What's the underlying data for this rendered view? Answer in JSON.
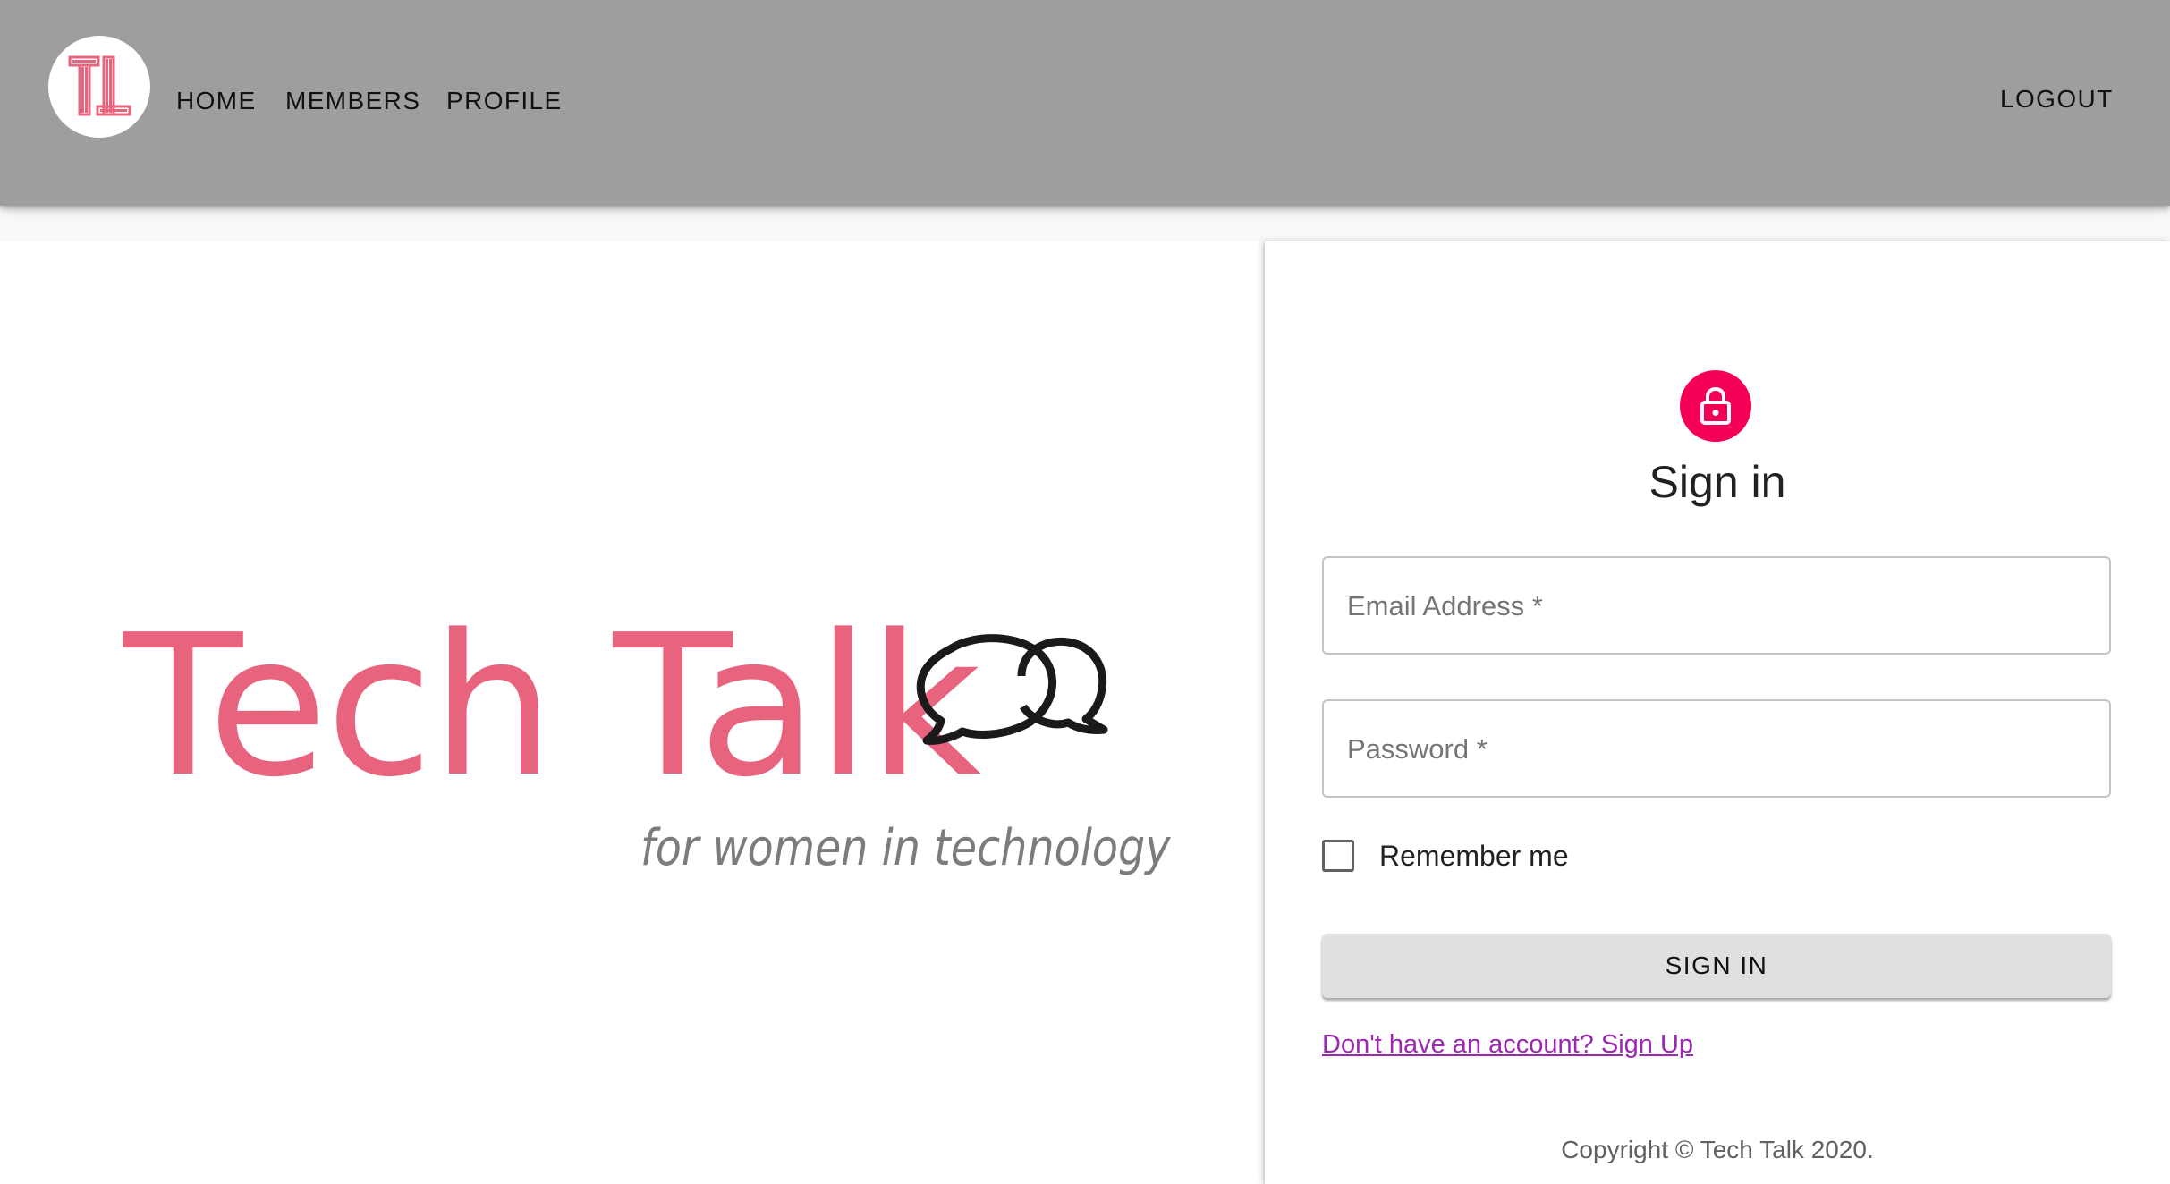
{
  "header": {
    "logo": {
      "icon": "tech-talk-monogram-icon",
      "text": "TT"
    },
    "nav": [
      {
        "label": "HOME"
      },
      {
        "label": "MEMBERS"
      },
      {
        "label": "PROFILE"
      }
    ],
    "logout_label": "LOGOUT"
  },
  "brand": {
    "title": "Tech Talk",
    "tagline": "for women in technology",
    "icon": "speech-bubbles-icon"
  },
  "signin": {
    "avatar_icon": "lock-icon",
    "title": "Sign in",
    "email_label": "Email Address *",
    "email_value": "",
    "password_label": "Password *",
    "password_value": "",
    "remember_label": "Remember me",
    "remember_checked": false,
    "button_label": "SIGN IN",
    "signup_link": "Don't have an account? Sign Up",
    "copyright": "Copyright © Tech Talk 2020."
  },
  "colors": {
    "appbar": "#9e9e9e",
    "brand_pink": "#e8637e",
    "avatar_pink": "#f50057",
    "link_purple": "#9c27b0",
    "button_grey": "#e0e0e0"
  }
}
